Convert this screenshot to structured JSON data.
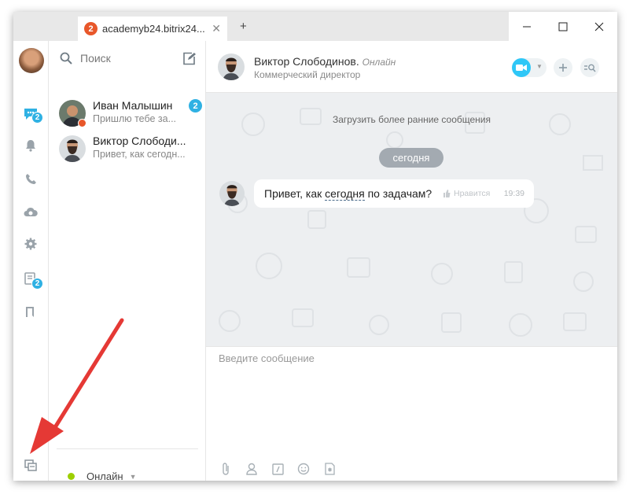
{
  "window": {
    "tab": {
      "badge": "2",
      "title": "academyb24.bitrix24..."
    },
    "new_tab_icon": "+",
    "controls": [
      "minimize-icon",
      "maximize-icon",
      "close-icon"
    ]
  },
  "rail": {
    "items": [
      {
        "icon": "chat-icon",
        "badge": "2"
      },
      {
        "icon": "bell-icon"
      },
      {
        "icon": "phone-icon"
      },
      {
        "icon": "cloud-sync-icon"
      },
      {
        "icon": "gear-icon"
      },
      {
        "icon": "tasks-icon",
        "badge": "2"
      },
      {
        "icon": "bookmark-icon"
      }
    ],
    "bottom_icon": "windows-icon"
  },
  "contacts": {
    "search_placeholder": "Поиск",
    "items": [
      {
        "name": "Иван Малышин",
        "message": "Пришлю тебе за...",
        "badge": "2",
        "status": "dnd"
      },
      {
        "name": "Виктор Слободи...",
        "message": "Привет, как сегодн..."
      }
    ],
    "status_label": "Онлайн",
    "status_color": "#9dcf00"
  },
  "chat": {
    "header": {
      "name": "Виктор Слободинов.",
      "status": "Онлайн",
      "title": "Коммерческий директор"
    },
    "load_earlier": "Загрузить более ранние сообщения",
    "date_label": "сегодня",
    "message": {
      "text_before": "Привет, как ",
      "text_keyword": "сегодня",
      "text_after": " по задачам?",
      "like_label": "Нравится",
      "time": "19:39"
    },
    "input_placeholder": "Введите сообщение"
  },
  "colors": {
    "accent": "#2fb1e3",
    "alert": "#e8572a",
    "video": "#2fc7f7",
    "annotation_arrow": "#e53935"
  }
}
